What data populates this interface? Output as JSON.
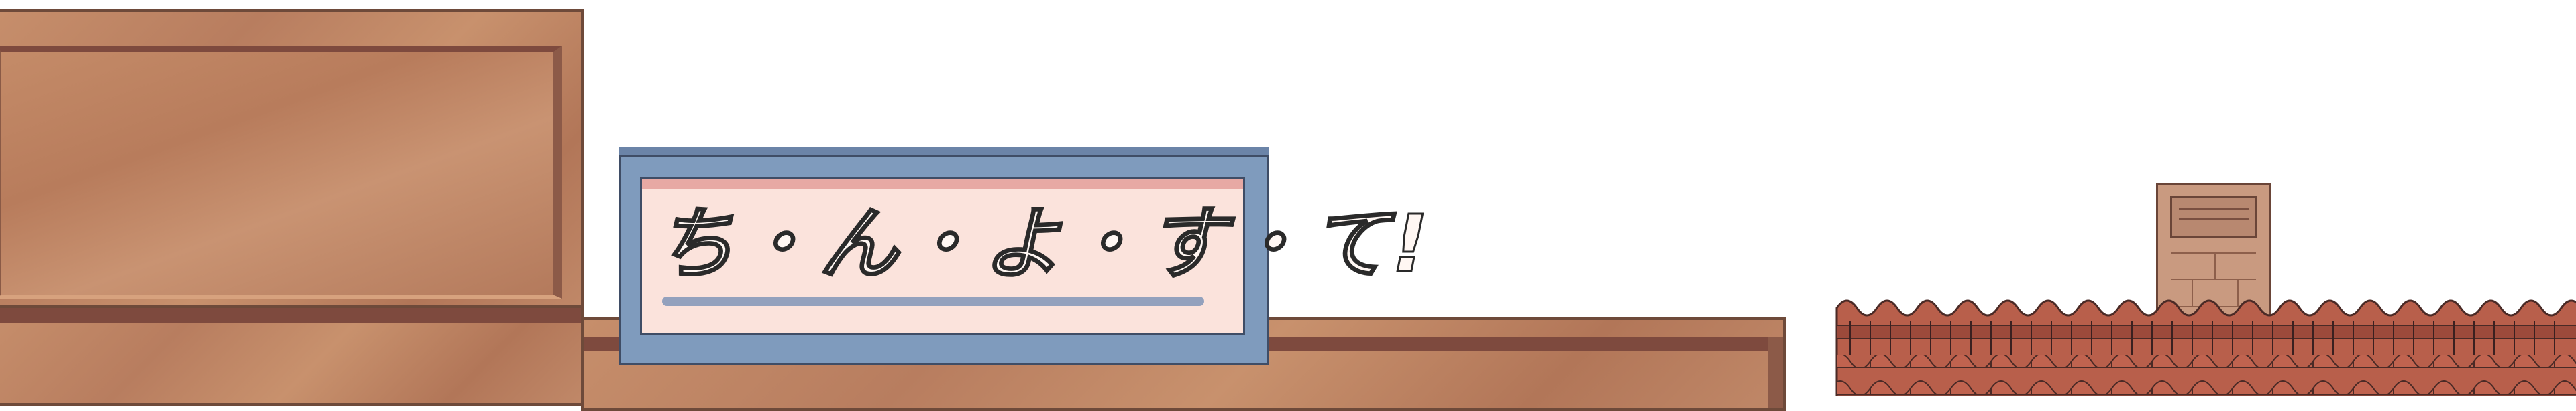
{
  "scene": {
    "shop_sign": {
      "text": "ち・ん・よ・す・て!",
      "frame_color": "#7f9bbd",
      "panel_color": "#fbe3dc"
    },
    "colors": {
      "wood": "#c68e6b",
      "wood_dark": "#7e4a3e",
      "outline": "#6e4a3a",
      "roof_tile": "#b45a48",
      "chimney": "#c99a80"
    },
    "icons": {
      "chimney": "chimney-icon",
      "roof": "tiled-roof-icon"
    }
  }
}
